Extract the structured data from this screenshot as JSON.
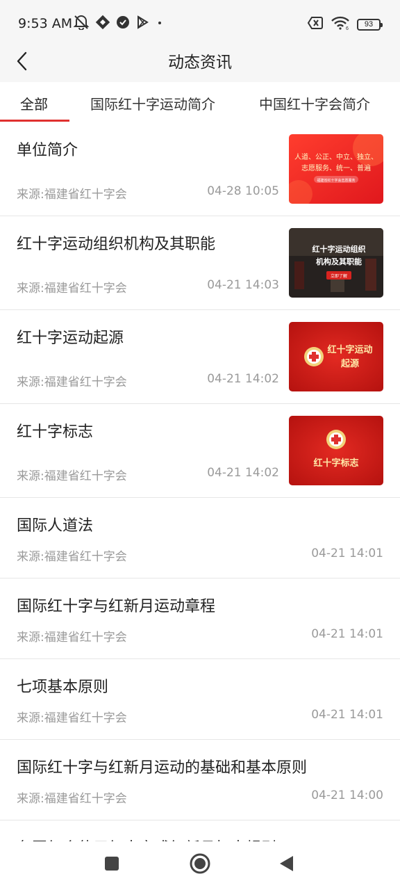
{
  "status_bar": {
    "time": "9:53 AM",
    "battery": "93",
    "icons": [
      "mute-icon",
      "app-icon",
      "check-badge-icon",
      "play-store-icon",
      "dot-icon",
      "no-sim-icon",
      "wifi-icon",
      "battery-icon"
    ]
  },
  "header": {
    "title": "动态资讯",
    "back_icon": "chevron-left-icon"
  },
  "tabs": [
    {
      "label": "全部",
      "active": true
    },
    {
      "label": "国际红十字运动简介",
      "active": false
    },
    {
      "label": "中国红十字会简介",
      "active": false
    }
  ],
  "articles": [
    {
      "title": "单位简介",
      "source": "来源:福建省红十字会",
      "time": "04-28 10:05",
      "thumb": {
        "lines": [
          "人道、公正、中立、独立、",
          "志愿服务、统一、普遍"
        ],
        "caption": "福建省红十字会志愿服务"
      }
    },
    {
      "title": "红十字运动组织机构及其职能",
      "source": "来源:福建省红十字会",
      "time": "04-21 14:03",
      "thumb": {
        "lines": [
          "红十字运动组织",
          "机构及其职能"
        ],
        "caption": "立即了解"
      }
    },
    {
      "title": "红十字运动起源",
      "source": "来源:福建省红十字会",
      "time": "04-21 14:02",
      "thumb": {
        "lines": [
          "红十字运动",
          "起源"
        ]
      }
    },
    {
      "title": "红十字标志",
      "source": "来源:福建省红十字会",
      "time": "04-21 14:02",
      "thumb": {
        "lines": [
          "红十字标志"
        ]
      }
    },
    {
      "title": "国际人道法",
      "source": "来源:福建省红十字会",
      "time": "04-21 14:01"
    },
    {
      "title": "国际红十字与红新月运动章程",
      "source": "来源:福建省红十字会",
      "time": "04-21 14:01"
    },
    {
      "title": "七项基本原则",
      "source": "来源:福建省红十字会",
      "time": "04-21 14:01"
    },
    {
      "title": "国际红十字与红新月运动的基础和基本原则",
      "source": "来源:福建省红十字会",
      "time": "04-21 14:00"
    },
    {
      "title": "各国红会使用红十字或红新月标志规则"
    }
  ],
  "colors": {
    "accent": "#e0312f",
    "text_primary": "#222222",
    "text_secondary": "#9a9a9a",
    "header_bg": "#f6f6f6"
  },
  "system_nav": [
    "recents-square-icon",
    "home-circle-icon",
    "back-triangle-icon"
  ]
}
